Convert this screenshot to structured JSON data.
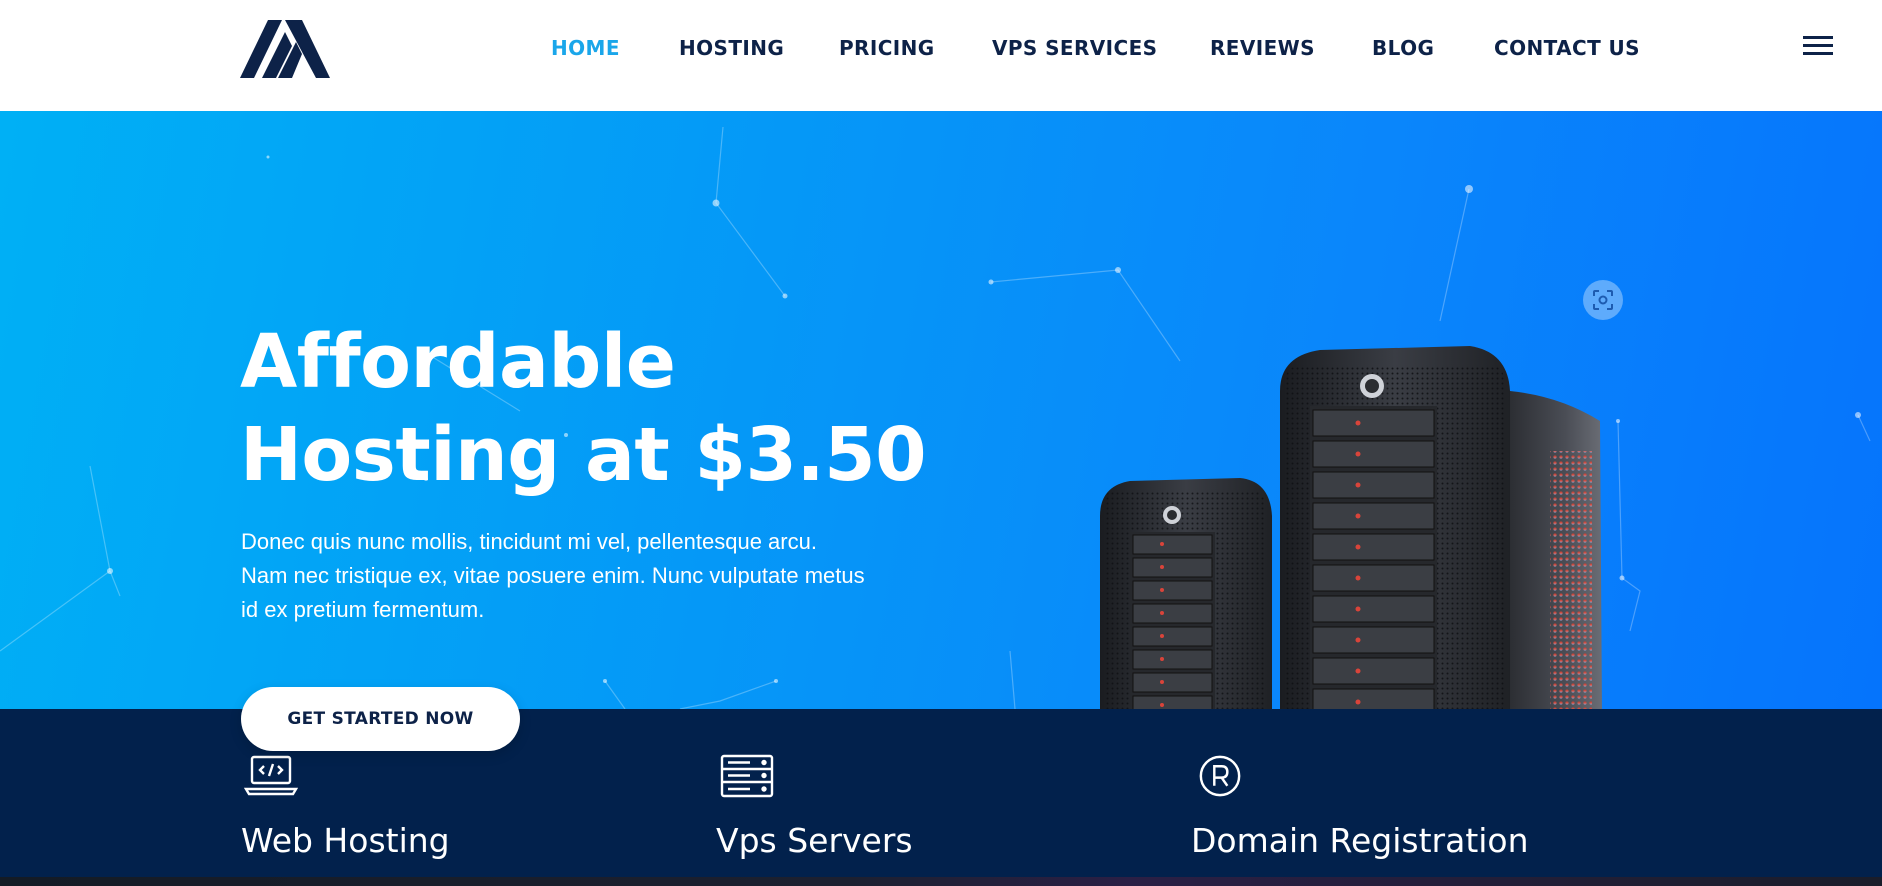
{
  "header": {
    "logo": "logo",
    "nav": [
      {
        "label": "HOME",
        "active": true
      },
      {
        "label": "HOSTING",
        "active": false
      },
      {
        "label": "PRICING",
        "active": false
      },
      {
        "label": "VPS SERVICES",
        "active": false
      },
      {
        "label": "REVIEWS",
        "active": false
      },
      {
        "label": "BLOG",
        "active": false
      },
      {
        "label": "CONTACT US",
        "active": false
      }
    ],
    "menu_icon": "hamburger-menu-icon"
  },
  "hero": {
    "title_line1": "Affordable",
    "title_line2": "Hosting at $3.50",
    "text_line1": "Donec quis nunc mollis, tincidunt mi vel, pellentesque arcu.",
    "text_line2": "Nam nec tristique ex, vitae posuere enim. Nunc vulputate metus",
    "text_line3": "id ex pretium fermentum.",
    "cta_label": "GET STARTED NOW",
    "image": "server-towers-image",
    "scan_icon": "visual-search-icon"
  },
  "features": [
    {
      "icon": "laptop-code-icon",
      "title": "Web Hosting"
    },
    {
      "icon": "server-rack-icon",
      "title": "Vps Servers"
    },
    {
      "icon": "registered-trademark-icon",
      "title": "Domain Registration"
    }
  ],
  "colors": {
    "navy": "#0d2248",
    "accent": "#1aa6ea",
    "hero_start": "#00b0f5",
    "hero_end": "#0574fc",
    "band": "#02214c",
    "white": "#ffffff"
  }
}
